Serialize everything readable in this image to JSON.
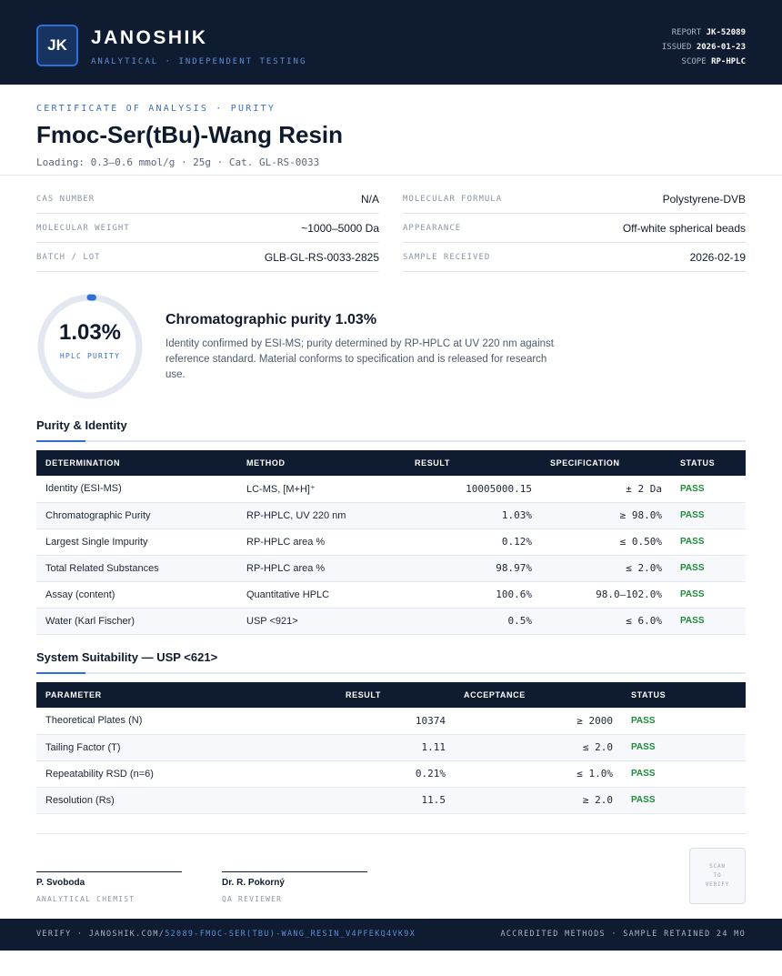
{
  "header": {
    "logo_initials": "JK",
    "brand": "JANOSHIK",
    "tagline": "ANALYTICAL · INDEPENDENT TESTING",
    "report_label": "REPORT",
    "report_value": "JK-52089",
    "issued_label": "ISSUED",
    "issued_value": "2026-01-23",
    "scope_label": "SCOPE",
    "scope_value": "RP-HPLC"
  },
  "title": {
    "kicker": "CERTIFICATE OF ANALYSIS · PURITY",
    "product": "Fmoc-Ser(tBu)-Wang Resin",
    "subline": "Loading: 0.3–0.6 mmol/g · 25g  ·  Cat. GL-RS-0033"
  },
  "info": {
    "cas_label": "CAS NUMBER",
    "cas_value": "N/A",
    "formula_label": "MOLECULAR FORMULA",
    "formula_value": "Polystyrene-DVB",
    "mw_label": "MOLECULAR WEIGHT",
    "mw_value": "~1000–5000 Da",
    "appearance_label": "APPEARANCE",
    "appearance_value": "Off-white spherical beads",
    "batch_label": "BATCH / LOT",
    "batch_value": "GLB-GL-RS-0033-2825",
    "received_label": "SAMPLE RECEIVED",
    "received_value": "2026-02-19"
  },
  "purity": {
    "value": "1.03%",
    "fraction": 0.0103,
    "ring_label": "HPLC PURITY",
    "title": "Chromatographic purity 1.03%",
    "text": "Identity confirmed by ESI-MS; purity determined by RP-HPLC at UV 220 nm against reference standard. Material conforms to specification and is released for research use."
  },
  "purity_table": {
    "title": "Purity & Identity",
    "headers": [
      "DETERMINATION",
      "METHOD",
      "RESULT",
      "SPECIFICATION",
      "STATUS"
    ],
    "rows": [
      [
        "Identity (ESI-MS)",
        "LC-MS, [M+H]⁺",
        "10005000.15",
        "± 2 Da",
        "PASS"
      ],
      [
        "Chromatographic Purity",
        "RP-HPLC, UV 220 nm",
        "1.03%",
        "≥ 98.0%",
        "PASS"
      ],
      [
        "Largest Single Impurity",
        "RP-HPLC area %",
        "0.12%",
        "≤ 0.50%",
        "PASS"
      ],
      [
        "Total Related Substances",
        "RP-HPLC area %",
        "98.97%",
        "≤ 2.0%",
        "PASS"
      ],
      [
        "Assay (content)",
        "Quantitative HPLC",
        "100.6%",
        "98.0–102.0%",
        "PASS"
      ],
      [
        "Water (Karl Fischer)",
        "USP <921>",
        "0.5%",
        "≤ 6.0%",
        "PASS"
      ]
    ]
  },
  "suitability_table": {
    "title": "System Suitability — USP <621>",
    "headers": [
      "PARAMETER",
      "RESULT",
      "ACCEPTANCE",
      "STATUS"
    ],
    "rows": [
      [
        "Theoretical Plates (N)",
        "10374",
        "≥ 2000",
        "PASS"
      ],
      [
        "Tailing Factor (T)",
        "1.11",
        "≤ 2.0",
        "PASS"
      ],
      [
        "Repeatability RSD (n=6)",
        "0.21%",
        "≤ 1.0%",
        "PASS"
      ],
      [
        "Resolution (Rs)",
        "11.5",
        "≥ 2.0",
        "PASS"
      ]
    ]
  },
  "signatures": {
    "sig1_name": "P. Svoboda",
    "sig1_role": "ANALYTICAL CHEMIST",
    "sig2_name": "Dr. R. Pokorný",
    "sig2_role": "QA REVIEWER",
    "qr_text": "SCAN TO VERIFY"
  },
  "footer": {
    "verify_prefix": "VERIFY · JANOSHIK.COM/",
    "verify_path": "52089-FMOC-SER(TBU)-WANG_RESIN_V4PFEKQ4VK9X",
    "right_text": "ACCREDITED METHODS · SAMPLE RETAINED 24 MO"
  },
  "colors": {
    "navy": "#0e1b30",
    "accent": "#2f6fd6",
    "pass": "#1e8a3c"
  }
}
